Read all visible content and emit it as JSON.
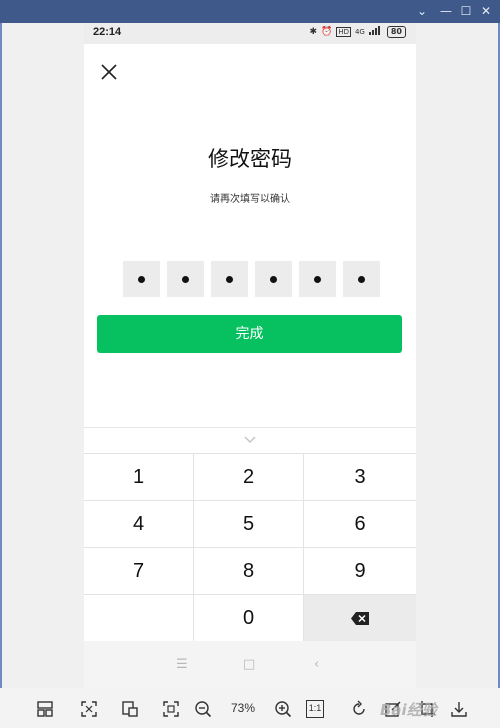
{
  "status_bar": {
    "time": "22:14",
    "network": "4G",
    "battery": "80"
  },
  "page": {
    "title": "修改密码",
    "subtitle": "请再次填写以确认",
    "done_label": "完成",
    "password_digits_filled": 6
  },
  "keyboard": {
    "keys": [
      "1",
      "2",
      "3",
      "4",
      "5",
      "6",
      "7",
      "8",
      "9",
      "",
      "0"
    ]
  },
  "viewer": {
    "zoom": "73%",
    "actual_size_label": "1:1",
    "watermark": "Bai经验"
  },
  "colors": {
    "accent": "#07c160",
    "titlebar": "#3f5a8a"
  },
  "icons": [
    "close-icon",
    "collapse-keyboard-icon",
    "backspace-icon",
    "bluetooth-icon",
    "alarm-icon",
    "signal-icon",
    "battery-icon"
  ]
}
